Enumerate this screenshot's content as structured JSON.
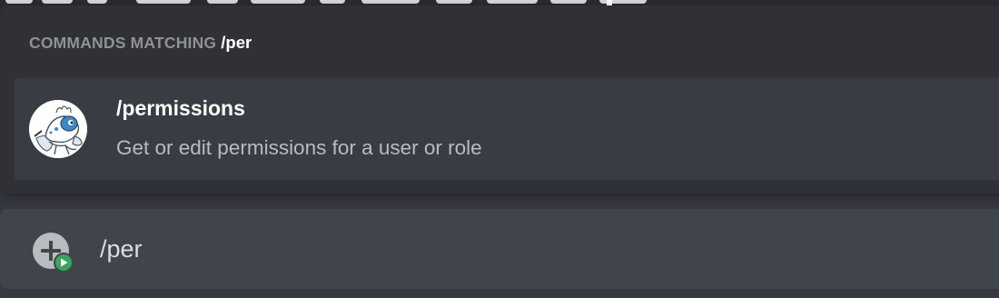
{
  "autocomplete": {
    "header_label": "COMMANDS MATCHING",
    "header_query": "/per",
    "commands": [
      {
        "name": "/permissions",
        "description": "Get or edit permissions for a user or role",
        "avatar_icon": "bot-avatar-icon"
      }
    ]
  },
  "composer": {
    "value": "/per",
    "attach_icon": "add-attachment-icon",
    "activity_icon": "activity-play-icon"
  },
  "colors": {
    "background": "#36393f",
    "popup": "#2f3136",
    "selected_row": "#393c43",
    "input_bar": "#40444b",
    "muted_text": "#8e9297",
    "description_text": "#b9bbbe",
    "activity_green": "#3ba55d"
  }
}
